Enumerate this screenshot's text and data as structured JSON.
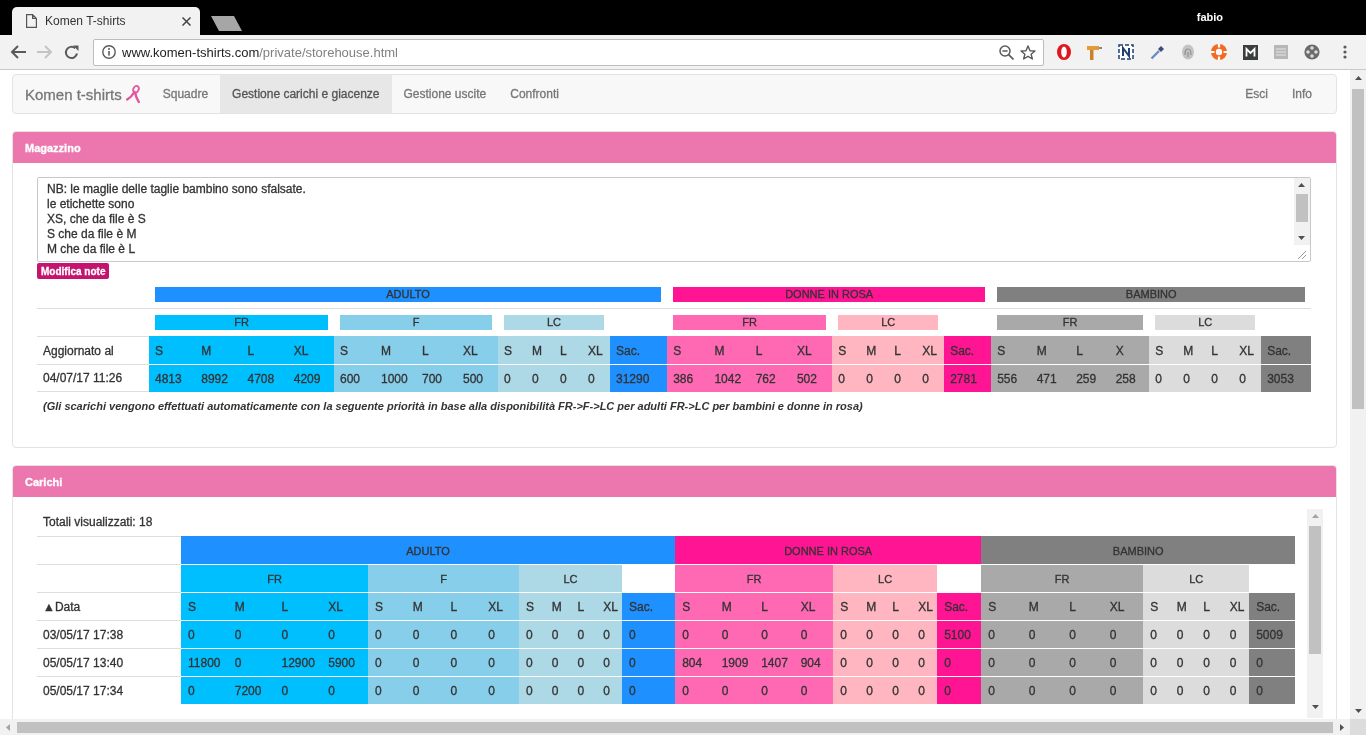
{
  "browser": {
    "tab_title": "Komen T-shirts",
    "profile": "fabio",
    "url_host": "www.komen-tshirts.com",
    "url_path": "/private/storehouse.html"
  },
  "navbar": {
    "brand": "Komen t-shirts",
    "items": [
      {
        "label": "Squadre",
        "selected": false
      },
      {
        "label": "Gestione carichi e giacenze",
        "selected": true
      },
      {
        "label": "Gestione uscite",
        "selected": false
      },
      {
        "label": "Confronti",
        "selected": false
      }
    ],
    "right_items": [
      "Esci",
      "Info"
    ]
  },
  "magazzino": {
    "title": "Magazzino",
    "notes": "NB: le maglie delle taglie bambino sono sfalsate.\nle etichette sono\nXS, che da file è S\nS che da file è M\nM che da file è L",
    "edit_button": "Modifica note",
    "table": {
      "row_header": "Aggiornato al",
      "groups": [
        {
          "name": "ADULTO",
          "color": "#1e90ff",
          "total_label": "Sac.",
          "subgroups": [
            {
              "name": "FR",
              "color": "#00bfff",
              "sizes": [
                "S",
                "M",
                "L",
                "XL"
              ]
            },
            {
              "name": "F",
              "color": "#87ceeb",
              "sizes": [
                "S",
                "M",
                "L",
                "XL"
              ]
            },
            {
              "name": "LC",
              "color": "#add8e6",
              "sizes": [
                "S",
                "M",
                "L",
                "XL"
              ]
            }
          ]
        },
        {
          "name": "DONNE IN ROSA",
          "color": "#ff1493",
          "total_label": "Sac.",
          "subgroups": [
            {
              "name": "FR",
              "color": "#ff69b4",
              "sizes": [
                "S",
                "M",
                "L",
                "XL"
              ]
            },
            {
              "name": "LC",
              "color": "#ffb6c1",
              "sizes": [
                "S",
                "M",
                "L",
                "XL"
              ]
            }
          ]
        },
        {
          "name": "BAMBINO",
          "color": "#808080",
          "total_label": "Sac.",
          "subgroups": [
            {
              "name": "FR",
              "color": "#a9a9a9",
              "sizes": [
                "S",
                "M",
                "L",
                "X"
              ]
            },
            {
              "name": "LC",
              "color": "#dcdcdc",
              "sizes": [
                "S",
                "M",
                "L",
                "XL"
              ]
            }
          ]
        }
      ],
      "rows": [
        {
          "label": "04/07/17 11:26",
          "values": [
            "4813",
            "8992",
            "4708",
            "4209",
            "600",
            "1000",
            "700",
            "500",
            "0",
            "0",
            "0",
            "0",
            "31290",
            "386",
            "1042",
            "762",
            "502",
            "0",
            "0",
            "0",
            "0",
            "2781",
            "556",
            "471",
            "259",
            "258",
            "0",
            "0",
            "0",
            "0",
            "3053"
          ]
        }
      ]
    },
    "footnote": "(Gli scarichi vengono effettuati automaticamente con la seguente priorità in base alla disponibilità FR->F->LC per adulti FR->LC per bambini e donne in rosa)"
  },
  "carichi": {
    "title": "Carichi",
    "count_text": "Totali visualizzati: 18",
    "table": {
      "row_header": "▲Data",
      "groups": [
        {
          "name": "ADULTO",
          "color": "#1e90ff",
          "total_label": "Sac.",
          "subgroups": [
            {
              "name": "FR",
              "color": "#00bfff",
              "sizes": [
                "S",
                "M",
                "L",
                "XL"
              ]
            },
            {
              "name": "F",
              "color": "#87ceeb",
              "sizes": [
                "S",
                "M",
                "L",
                "XL"
              ]
            },
            {
              "name": "LC",
              "color": "#add8e6",
              "sizes": [
                "S",
                "M",
                "L",
                "XL"
              ]
            }
          ]
        },
        {
          "name": "DONNE IN ROSA",
          "color": "#ff1493",
          "total_label": "Sac.",
          "subgroups": [
            {
              "name": "FR",
              "color": "#ff69b4",
              "sizes": [
                "S",
                "M",
                "L",
                "XL"
              ]
            },
            {
              "name": "LC",
              "color": "#ffb6c1",
              "sizes": [
                "S",
                "M",
                "L",
                "XL"
              ]
            }
          ]
        },
        {
          "name": "BAMBINO",
          "color": "#808080",
          "total_label": "Sac.",
          "subgroups": [
            {
              "name": "FR",
              "color": "#a9a9a9",
              "sizes": [
                "S",
                "M",
                "L",
                "XL"
              ]
            },
            {
              "name": "LC",
              "color": "#dcdcdc",
              "sizes": [
                "S",
                "M",
                "L",
                "XL"
              ]
            }
          ]
        }
      ],
      "rows": [
        {
          "label": "03/05/17 17:38",
          "values": [
            "0",
            "0",
            "0",
            "0",
            "0",
            "0",
            "0",
            "0",
            "0",
            "0",
            "0",
            "0",
            "0",
            "0",
            "0",
            "0",
            "0",
            "0",
            "0",
            "0",
            "0",
            "5100",
            "0",
            "0",
            "0",
            "0",
            "0",
            "0",
            "0",
            "0",
            "5009"
          ]
        },
        {
          "label": "05/05/17 13:40",
          "values": [
            "11800",
            "0",
            "12900",
            "5900",
            "0",
            "0",
            "0",
            "0",
            "0",
            "0",
            "0",
            "0",
            "0",
            "804",
            "1909",
            "1407",
            "904",
            "0",
            "0",
            "0",
            "0",
            "0",
            "0",
            "0",
            "0",
            "0",
            "0",
            "0",
            "0",
            "0",
            "0"
          ]
        },
        {
          "label": "05/05/17 17:34",
          "values": [
            "0",
            "7200",
            "0",
            "0",
            "0",
            "0",
            "0",
            "0",
            "0",
            "0",
            "0",
            "0",
            "0",
            "0",
            "0",
            "0",
            "0",
            "0",
            "0",
            "0",
            "0",
            "0",
            "0",
            "0",
            "0",
            "0",
            "0",
            "0",
            "0",
            "0",
            "0"
          ]
        }
      ]
    }
  }
}
